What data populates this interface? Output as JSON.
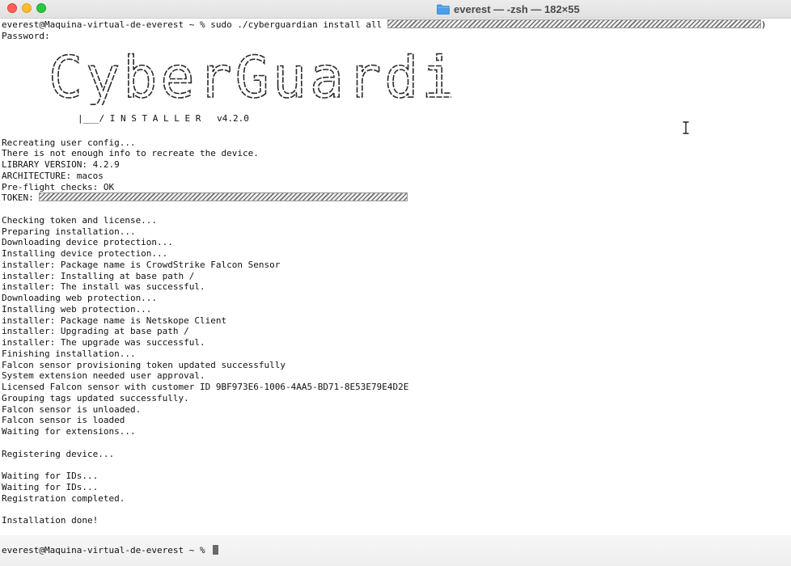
{
  "window": {
    "title": "everest — -zsh — 182×55"
  },
  "terminal": {
    "command_prompt": "everest@Maquina-virtual-de-everest ~ % sudo ./cyberguardian install all ",
    "command_tail": ")",
    "password_line": "Password:",
    "banner": {
      "word": "CyberGuardian",
      "subtitle": "|___/ I N S T A L L E R   v4.2.0"
    },
    "lines_a": [
      "Recreating user config...",
      "There is not enough info to recreate the device.",
      "LIBRARY VERSION: 4.2.9",
      "ARCHITECTURE: macos",
      "Pre-flight checks: OK"
    ],
    "token_label": "TOKEN: ",
    "lines_b": [
      "",
      "Checking token and license...",
      "Preparing installation...",
      "Downloading device protection...",
      "Installing device protection...",
      "installer: Package name is CrowdStrike Falcon Sensor",
      "installer: Installing at base path /",
      "installer: The install was successful.",
      "Downloading web protection...",
      "Installing web protection...",
      "installer: Package name is Netskope Client",
      "installer: Upgrading at base path /",
      "installer: The upgrade was successful.",
      "Finishing installation...",
      "Falcon sensor provisioning token updated successfully",
      "System extension needed user approval.",
      "Licensed Falcon sensor with customer ID 9BF973E6-1006-4AA5-BD71-8E53E79E4D2E",
      "Grouping tags updated successfully.",
      "Falcon sensor is unloaded.",
      "Falcon sensor is loaded",
      "Waiting for extensions...",
      "",
      "Registering device...",
      "",
      "Waiting for IDs...",
      "Waiting for IDs...",
      "Registration completed.",
      "",
      "Installation done!"
    ],
    "final_prompt": "everest@Maquina-virtual-de-everest ~ % "
  },
  "colors": {
    "background": "#ffffff",
    "text": "#111111",
    "close": "#ff5f57",
    "minimize": "#febc2e",
    "maximize": "#28c840",
    "folder": "#4a9fe8"
  },
  "icons": {
    "folder": "folder-icon",
    "cursor": "text-cursor-icon"
  }
}
